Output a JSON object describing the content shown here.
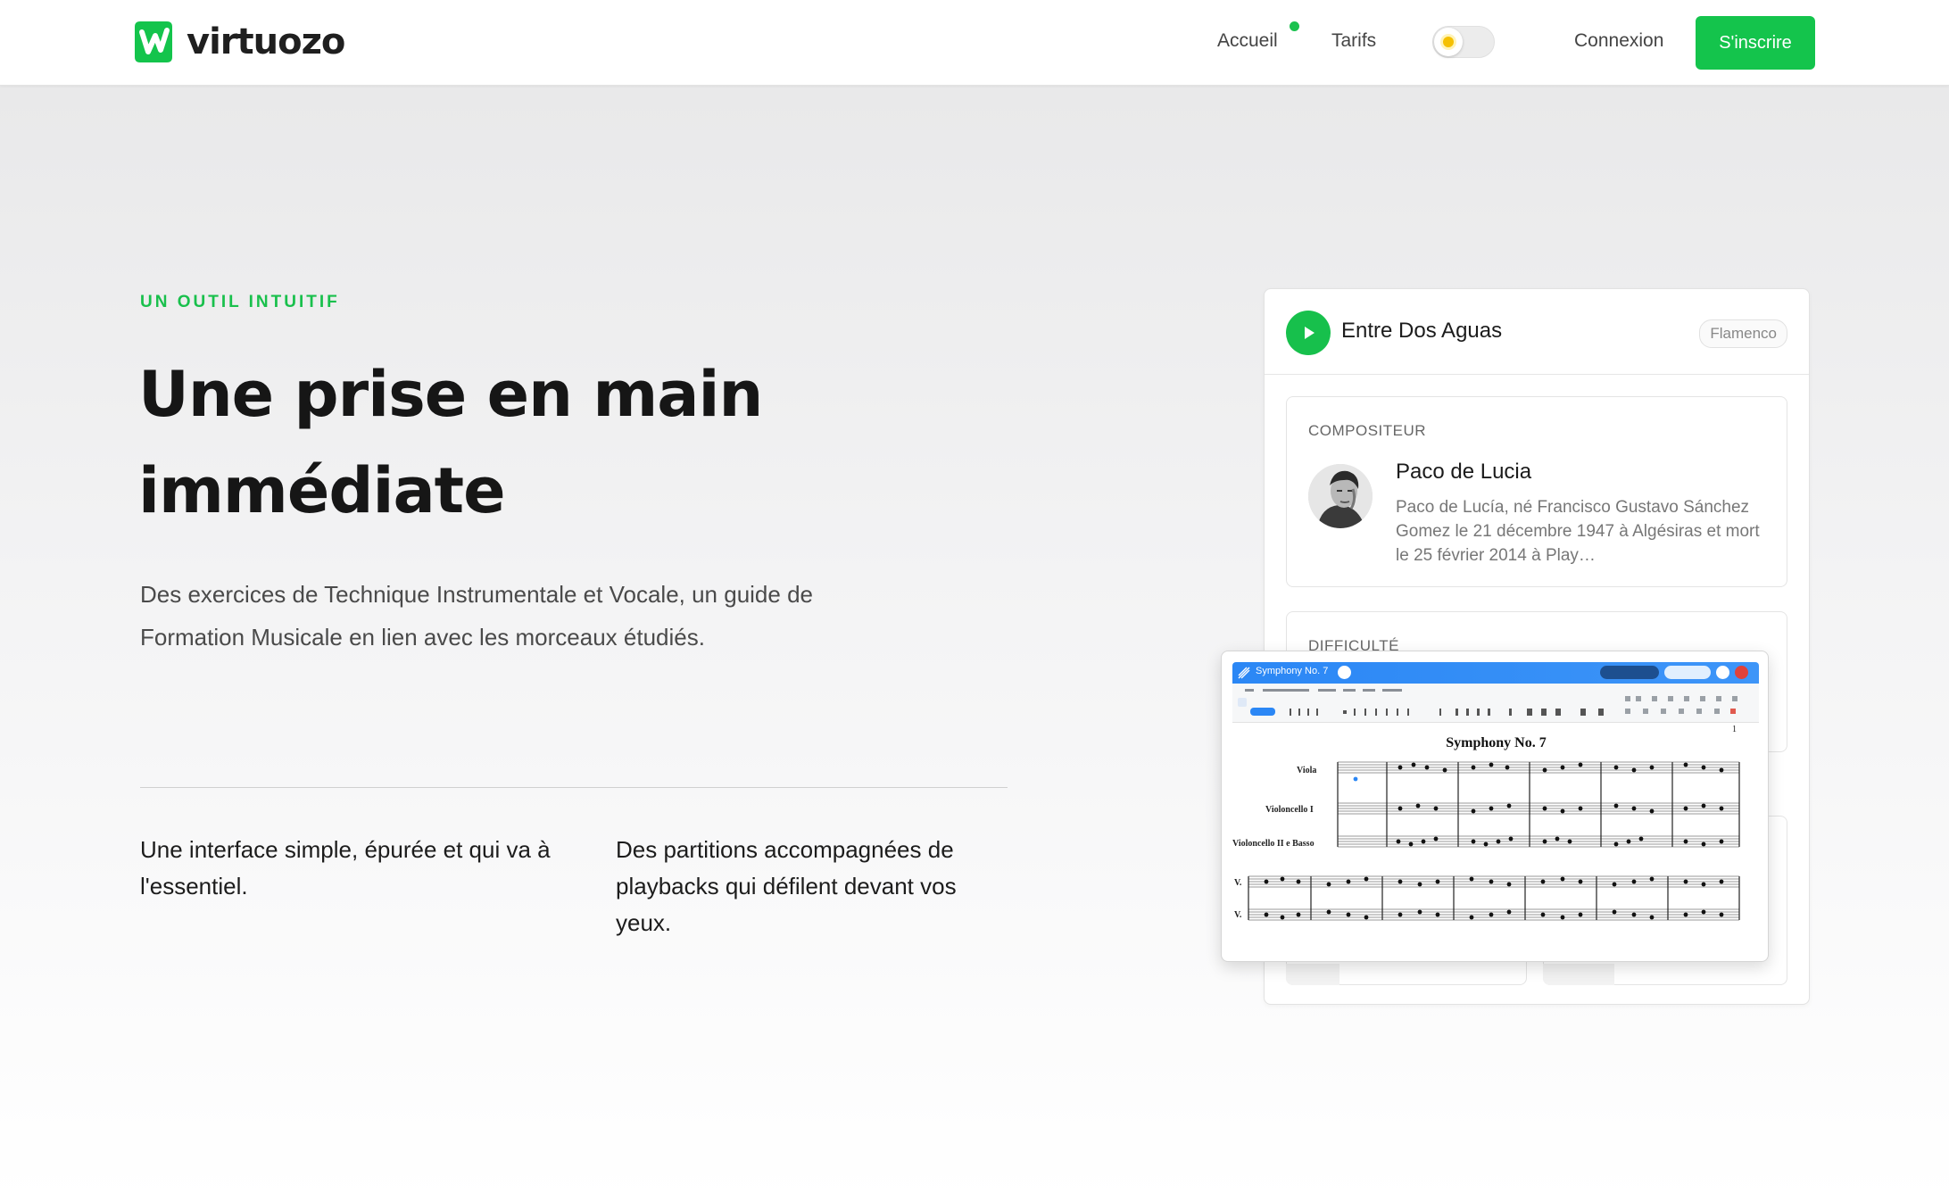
{
  "header": {
    "brand": "virtuozo",
    "nav": {
      "home": "Accueil",
      "pricing": "Tarifs",
      "login": "Connexion"
    },
    "signup_label": "S'inscrire",
    "theme_mode": "light"
  },
  "hero": {
    "eyebrow": "UN OUTIL INTUITIF",
    "title_line1": "Une prise en main",
    "title_line2": "immédiate",
    "lead": "Des exercices de Technique Instrumentale et Vocale, un guide de Formation Musicale en lien avec les morceaux étudiés.",
    "features": [
      "Une interface simple, épurée et qui va à l'essentiel.",
      "Des partitions accompagnées de playbacks qui défilent devant vos yeux."
    ]
  },
  "preview": {
    "song_title": "Entre Dos Aguas",
    "genre": "Flamenco",
    "composer_label": "COMPOSITEUR",
    "composer_name": "Paco de Lucia",
    "composer_bio": "Paco de Lucía, né Francisco Gustavo Sánchez Gomez le 21 décembre 1947 à Algésiras et mort le 25 février 2014 à Play…",
    "difficulty_label": "DIFFICULTÉ",
    "score": {
      "doc_title": "Symphony No. 7",
      "heading": "Symphony No. 7",
      "staves": [
        "Viola",
        "Violoncello I",
        "Violoncello II e Basso"
      ],
      "system2": [
        "V.",
        "V."
      ],
      "page_number": "1"
    }
  },
  "colors": {
    "accent": "#14c44c",
    "text": "#1a1a1a",
    "muted": "#777777",
    "score_bar": "#2b87f5"
  },
  "icons": [
    "logo-icon",
    "sun-icon",
    "play-icon"
  ]
}
